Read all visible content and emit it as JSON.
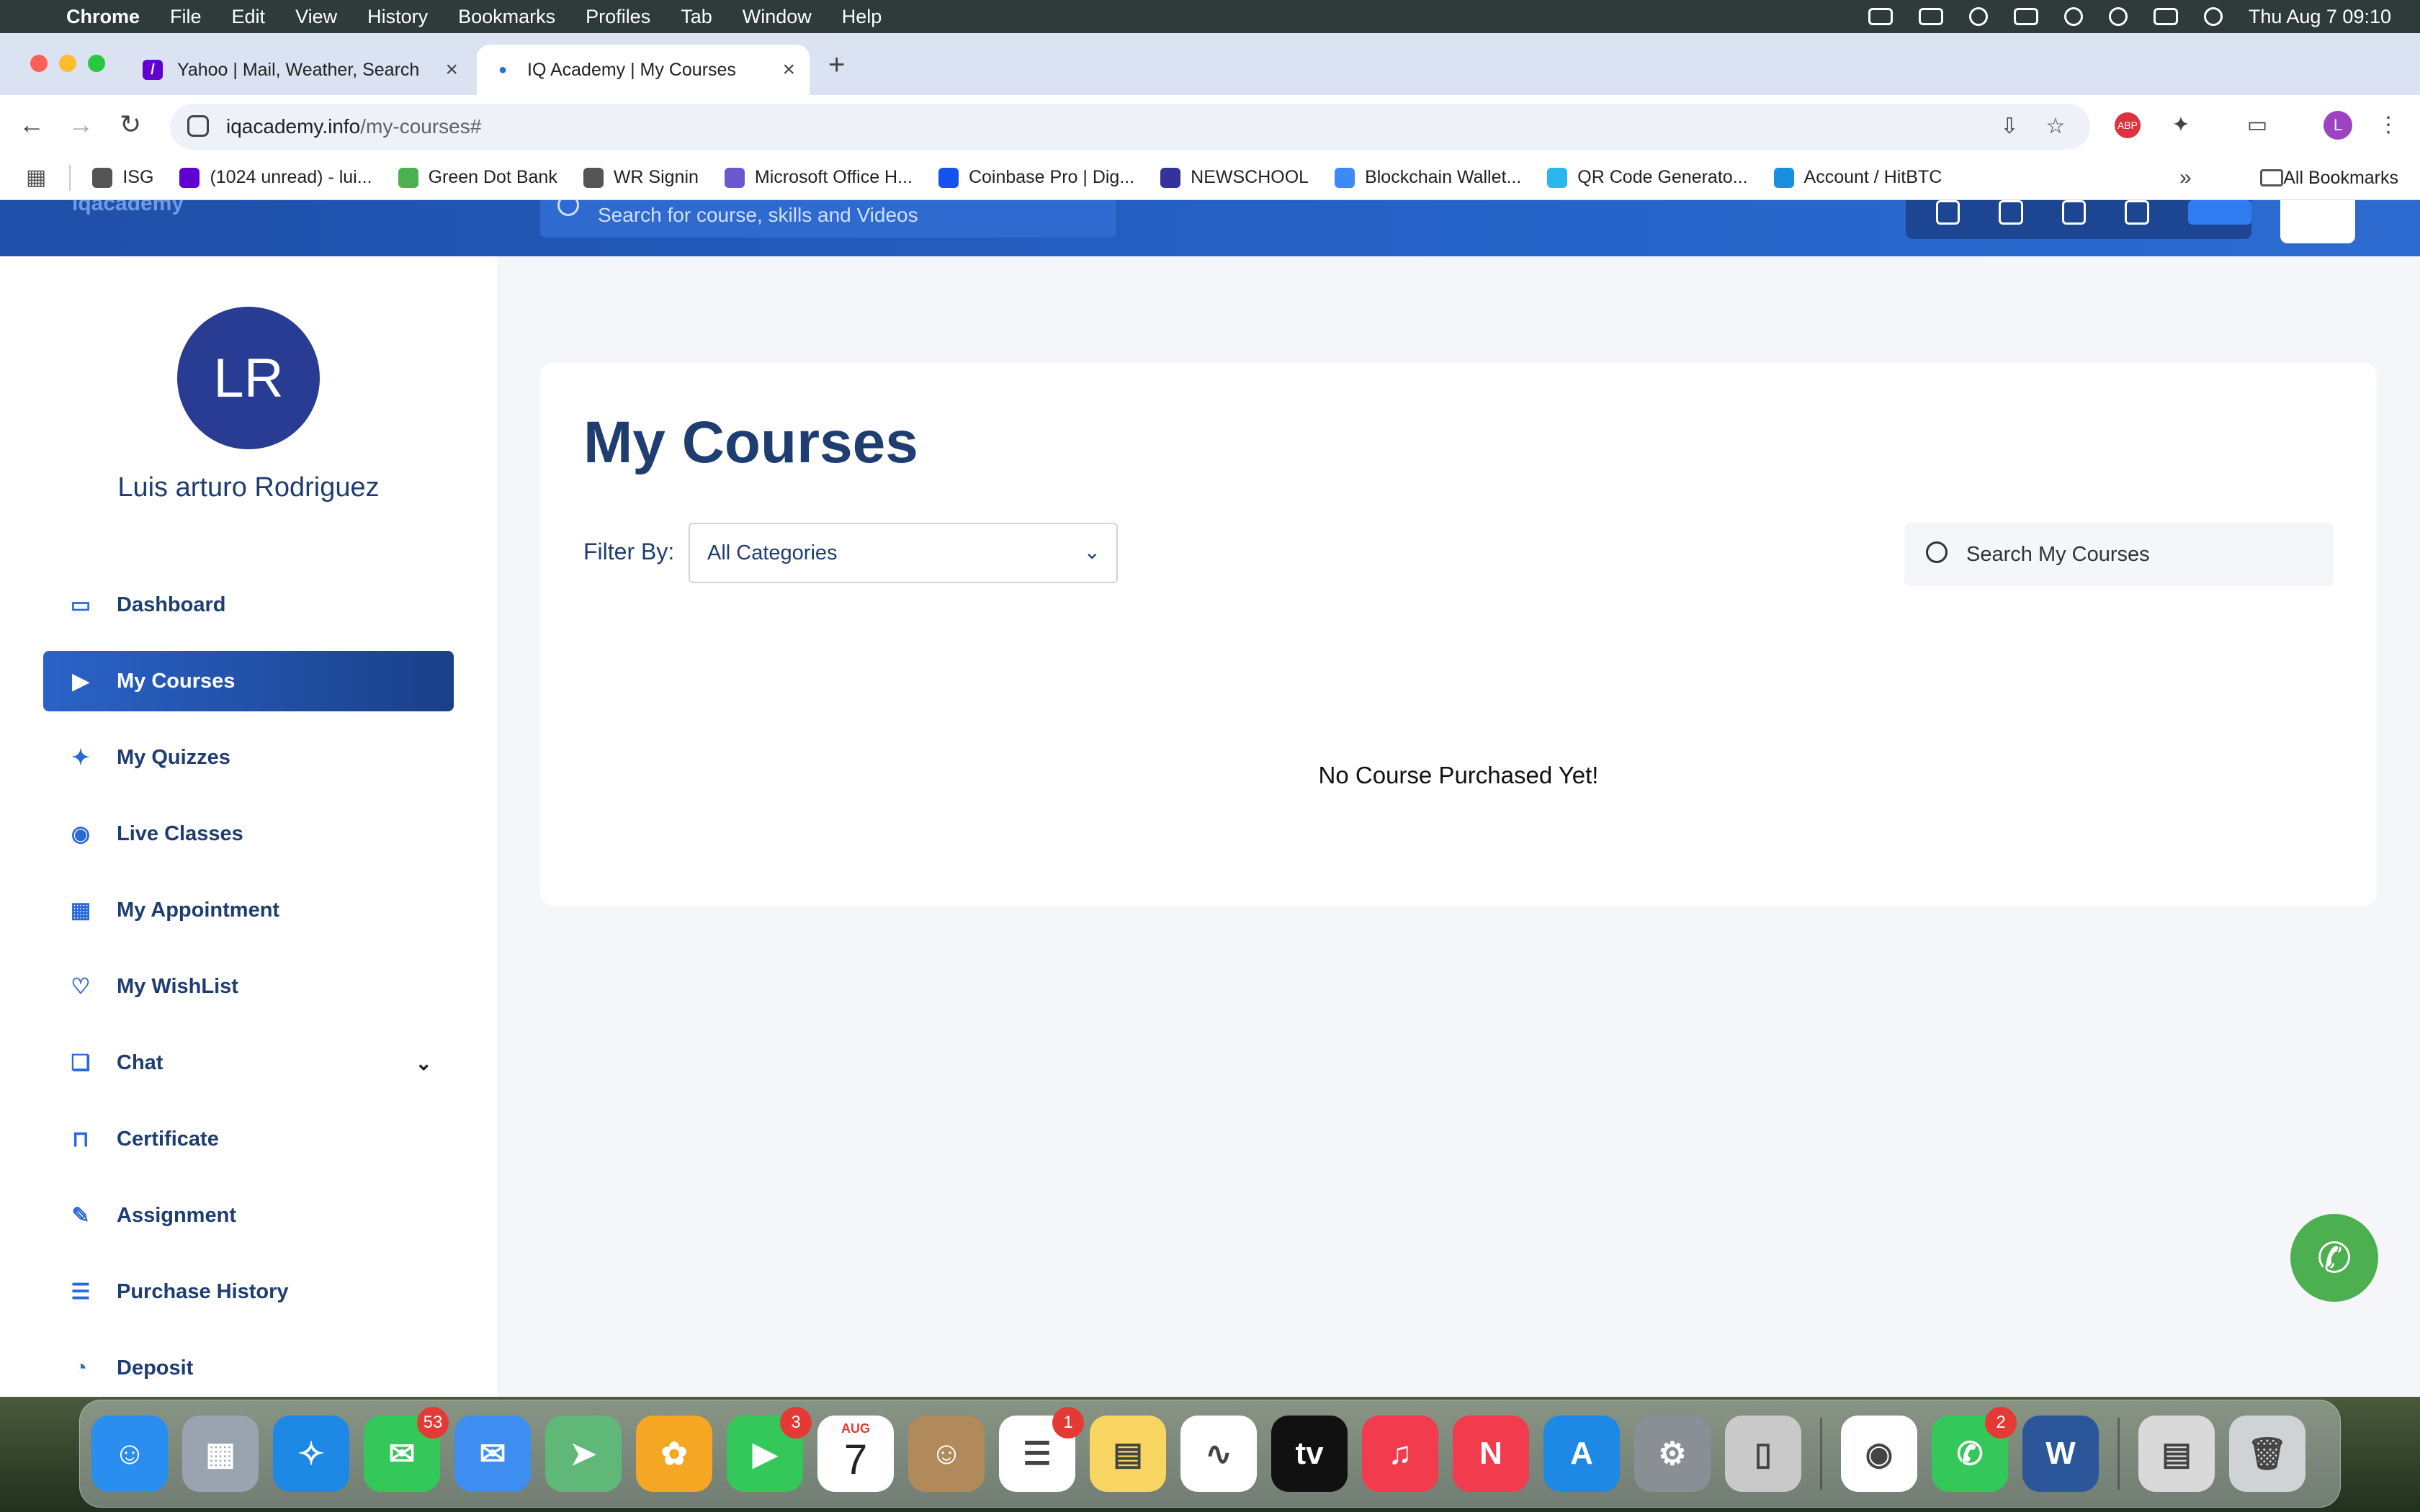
{
  "menubar": {
    "app_name": "Chrome",
    "items": [
      "File",
      "Edit",
      "View",
      "History",
      "Bookmarks",
      "Profiles",
      "Tab",
      "Window",
      "Help"
    ],
    "datetime": "Thu Aug 7  09:10"
  },
  "tabs": [
    {
      "title": "Yahoo | Mail, Weather, Search",
      "active": false
    },
    {
      "title": "IQ Academy | My Courses",
      "active": true
    }
  ],
  "omnibox": {
    "host": "iqacademy.info",
    "path": "/my-courses#"
  },
  "profile_initial": "L",
  "bookmarks": {
    "items": [
      {
        "label": "ISG",
        "icon": "folder-icon",
        "color": "#555555"
      },
      {
        "label": "(1024 unread) - lui...",
        "icon": "mail-icon",
        "color": "#6001d2"
      },
      {
        "label": "Green Dot Bank",
        "icon": "green-dot-icon",
        "color": "#4caf50"
      },
      {
        "label": "WR Signin",
        "icon": "globe-icon",
        "color": "#555555"
      },
      {
        "label": "Microsoft Office H...",
        "icon": "office-icon",
        "color": "#6a5acd"
      },
      {
        "label": "Coinbase Pro | Dig...",
        "icon": "coinbase-icon",
        "color": "#1652f0"
      },
      {
        "label": "NEWSCHOOL",
        "icon": "newschool-icon",
        "color": "#333399"
      },
      {
        "label": "Blockchain Wallet...",
        "icon": "blockchain-icon",
        "color": "#3d89f5"
      },
      {
        "label": "QR Code Generato...",
        "icon": "qr-icon",
        "color": "#2ab7f0"
      },
      {
        "label": "Account / HitBTC",
        "icon": "hitbtc-icon",
        "color": "#1a8fe0"
      }
    ],
    "all_label": "All Bookmarks"
  },
  "site_header": {
    "search_placeholder": "Search for course, skills and Videos",
    "logo_text": "iqacademy"
  },
  "user": {
    "initials": "LR",
    "name": "Luis arturo Rodriguez"
  },
  "nav": [
    {
      "label": "Dashboard",
      "icon": "monitor-icon",
      "glyph": "▭",
      "active": false
    },
    {
      "label": "My Courses",
      "icon": "play-icon",
      "glyph": "▶",
      "active": true
    },
    {
      "label": "My Quizzes",
      "icon": "puzzle-icon",
      "glyph": "✦",
      "active": false
    },
    {
      "label": "Live Classes",
      "icon": "broadcast-icon",
      "glyph": "◉",
      "active": false
    },
    {
      "label": "My Appointment",
      "icon": "calendar-icon",
      "glyph": "▦",
      "active": false
    },
    {
      "label": "My WishList",
      "icon": "heart-icon",
      "glyph": "♡",
      "active": false
    },
    {
      "label": "Chat",
      "icon": "chat-icon",
      "glyph": "❏",
      "active": false
    },
    {
      "label": "Certificate",
      "icon": "bookmark-icon",
      "glyph": "⊓",
      "active": false
    },
    {
      "label": "Assignment",
      "icon": "pen-icon",
      "glyph": "✎",
      "active": false
    },
    {
      "label": "Purchase History",
      "icon": "receipt-icon",
      "glyph": "☰",
      "active": false
    },
    {
      "label": "Deposit",
      "icon": "deposit-icon",
      "glyph": "◔",
      "active": false
    }
  ],
  "main": {
    "title": "My Courses",
    "filter_label": "Filter By:",
    "filter_value": "All Categories",
    "search_placeholder": "Search My Courses",
    "empty_message": "No Course Purchased Yet!"
  },
  "dock": [
    {
      "name": "finder-app",
      "glyph": "☺",
      "color": "#2a8df0"
    },
    {
      "name": "launchpad-app",
      "glyph": "▦",
      "color": "#9aa4b0"
    },
    {
      "name": "safari-app",
      "glyph": "✧",
      "color": "#1e88e5"
    },
    {
      "name": "messages-app",
      "glyph": "✉",
      "color": "#34c759",
      "badge": "53"
    },
    {
      "name": "mail-app",
      "glyph": "✉",
      "color": "#3d8ef0"
    },
    {
      "name": "maps-app",
      "glyph": "➤",
      "color": "#5fb878"
    },
    {
      "name": "photos-app",
      "glyph": "✿",
      "color": "#f5a623"
    },
    {
      "name": "facetime-app",
      "glyph": "▶",
      "color": "#34c759",
      "badge": "3"
    },
    {
      "name": "calendar-app",
      "glyph": "",
      "color": "#ffffff",
      "month": "AUG",
      "day": "7"
    },
    {
      "name": "contacts-app",
      "glyph": "☺",
      "color": "#b08a5a"
    },
    {
      "name": "reminders-app",
      "glyph": "☰",
      "color": "#ffffff",
      "badge": "1"
    },
    {
      "name": "notes-app",
      "glyph": "▤",
      "color": "#f7d560"
    },
    {
      "name": "freeform-app",
      "glyph": "∿",
      "color": "#ffffff"
    },
    {
      "name": "tv-app",
      "glyph": "tv",
      "color": "#111111"
    },
    {
      "name": "music-app",
      "glyph": "♫",
      "color": "#f23b4c"
    },
    {
      "name": "news-app",
      "glyph": "N",
      "color": "#f23b4c"
    },
    {
      "name": "appstore-app",
      "glyph": "A",
      "color": "#1e88e5"
    },
    {
      "name": "settings-app",
      "glyph": "⚙",
      "color": "#8a8f96"
    },
    {
      "name": "iphone-mirroring-app",
      "glyph": "▯",
      "color": "#c9c9c9"
    },
    {
      "name": "chrome-app",
      "glyph": "◉",
      "color": "#ffffff",
      "separator_before": true
    },
    {
      "name": "whatsapp-app",
      "glyph": "✆",
      "color": "#34c759",
      "badge": "2"
    },
    {
      "name": "word-app",
      "glyph": "W",
      "color": "#2b579a"
    },
    {
      "name": "documents-stack",
      "glyph": "▤",
      "color": "#d9d9d9",
      "separator_before": true
    },
    {
      "name": "trash",
      "glyph": "🗑",
      "color": "#cfd3d6"
    }
  ]
}
